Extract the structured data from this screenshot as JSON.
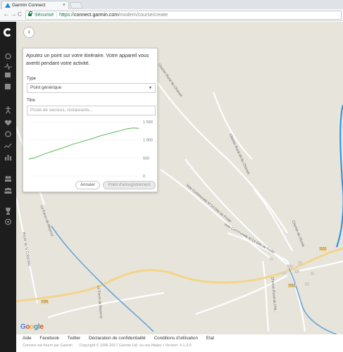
{
  "browser": {
    "tab_title": "Garmin Connect",
    "tab_close": "×",
    "back": "←",
    "forward": "→",
    "reload": "C",
    "security_label": "Sécurisé",
    "url_scheme": "https://",
    "url_host": "connect.garmin.com",
    "url_path": "/modern/course/create"
  },
  "sidebar": {
    "icons": [
      "logo-icon",
      "dashboard-icon",
      "pulse-icon",
      "calendar-icon",
      "list-icon",
      "training-icon",
      "heart-icon",
      "stopwatch-icon",
      "insights-icon",
      "reports-icon",
      "connections-icon",
      "groups-icon",
      "trophy-icon",
      "target-icon"
    ]
  },
  "map": {
    "collapse_label": "›",
    "google_logo": [
      "G",
      "o",
      "o",
      "g",
      "l",
      "e"
    ],
    "google_colors": [
      "#4285f4",
      "#ea4335",
      "#fbbc05",
      "#4285f4",
      "#34a853",
      "#ea4335"
    ],
    "road_labels": [
      "Chemin Rural du Charvet",
      "Chemin Rural dit du Charvet",
      "Voie Communale N°14 Dite de Frolel",
      "Voie Communale N°14 Dite de Frolel",
      "Chemin de l'Ecole",
      "Le Foron de Reyvroz",
      "Route de la Cobordaz",
      "Le Foron de Reyvroz",
      "Chemin Rural de l'Alt...",
      "D22",
      "D22",
      "D26"
    ]
  },
  "panel": {
    "message": "Ajoutez un point sur votre itinéraire. Votre appareil vous avertit pendant votre activité.",
    "type_label": "Type",
    "type_value": "Point générique",
    "title_label": "Titre",
    "title_placeholder": "Poste de secours, restaurants...",
    "cancel_label": "Annuler",
    "save_label": "Point d'enregistrement"
  },
  "chart_data": {
    "type": "line",
    "y_ticks": [
      "1 500",
      "1 000",
      "500",
      "0"
    ],
    "ylim": [
      0,
      1500
    ],
    "series": [
      {
        "color": "#5cb85c",
        "x": [
          0,
          5,
          10,
          15,
          20,
          25,
          30,
          35,
          40,
          45,
          50,
          55,
          60,
          65,
          70,
          75,
          80,
          85,
          90,
          95,
          100
        ],
        "values": [
          470,
          500,
          560,
          620,
          670,
          720,
          770,
          820,
          880,
          920,
          970,
          1010,
          1060,
          1110,
          1150,
          1190,
          1230,
          1270,
          1310,
          1330,
          1320
        ]
      }
    ]
  },
  "footer": {
    "links": [
      "Aide",
      "Facebook",
      "Twitter",
      "Déclaration de confidentialité",
      "Conditions d'utilisation",
      "Etat"
    ],
    "powered": "Connect est fourni par Garmin",
    "copyright": "Copyright © 1996-2017 Garmin Ltd. ou ses filiales • Version: 4.1-3.0"
  }
}
